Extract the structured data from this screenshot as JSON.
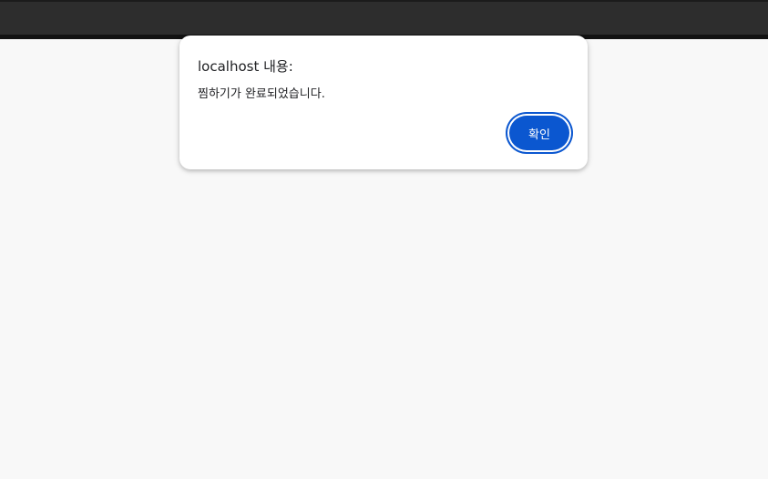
{
  "dialog": {
    "title": "localhost 내용:",
    "message": "찜하기가 완료되었습니다.",
    "ok_label": "확인"
  },
  "colors": {
    "topbar": "#2d2d2d",
    "page_background": "#f8f8f8",
    "dialog_background": "#ffffff",
    "accent": "#0b57d0"
  }
}
